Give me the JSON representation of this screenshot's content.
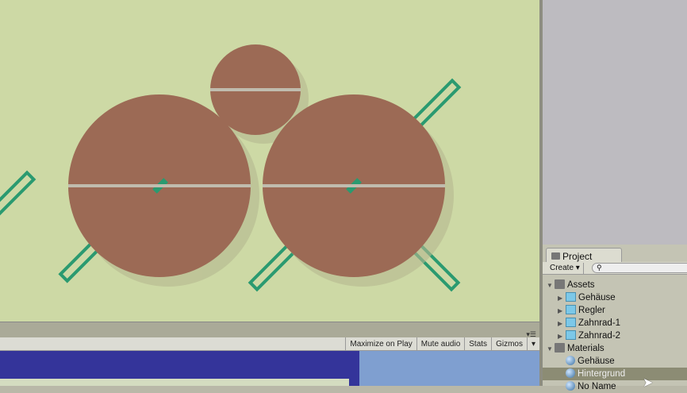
{
  "scene": {
    "background": "#cdd9a5",
    "gear_color": "#9c6a55",
    "bar_color": "#2a9a70"
  },
  "game_toolbar": {
    "buttons": [
      "Maximize on Play",
      "Mute audio",
      "Stats",
      "Gizmos"
    ],
    "menu_icon": "menu-icon"
  },
  "project": {
    "tab_label": "Project",
    "create_label": "Create",
    "search_placeholder": "",
    "items": [
      {
        "label": "Assets",
        "type": "folder",
        "expanded": true,
        "level": 0
      },
      {
        "label": "Gehäuse",
        "type": "prefab",
        "level": 1
      },
      {
        "label": "Regler",
        "type": "prefab",
        "level": 1
      },
      {
        "label": "Zahnrad-1",
        "type": "prefab",
        "level": 1
      },
      {
        "label": "Zahnrad-2",
        "type": "prefab",
        "level": 1
      },
      {
        "label": "Materials",
        "type": "folder",
        "expanded": true,
        "level": 0
      },
      {
        "label": "Gehäuse",
        "type": "material",
        "level": 1
      },
      {
        "label": "Hintergrund",
        "type": "material",
        "level": 1,
        "selected": true
      },
      {
        "label": "No Name",
        "type": "material",
        "level": 1
      }
    ]
  }
}
